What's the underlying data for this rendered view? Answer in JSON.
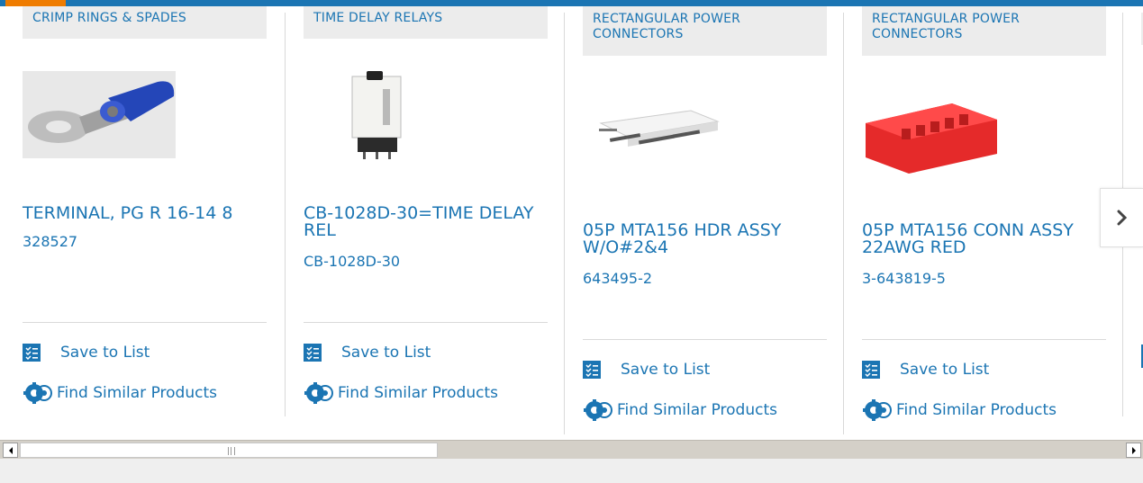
{
  "cards": [
    {
      "category": "CRIMP RINGS & SPADES",
      "title": "TERMINAL, PG R 16-14 8",
      "part_number": "328527",
      "save_label": "Save to List",
      "similar_label": "Find Similar Products"
    },
    {
      "category": "TIME DELAY RELAYS",
      "title": "CB-1028D-30=TIME DELAY REL",
      "part_number": "CB-1028D-30",
      "save_label": "Save to List",
      "similar_label": "Find Similar Products"
    },
    {
      "category": "RECTANGULAR POWER CONNECTORS",
      "title": "05P MTA156 HDR ASSY W/O#2&4",
      "part_number": "643495-2",
      "save_label": "Save to List",
      "similar_label": "Find Similar Products"
    },
    {
      "category": "RECTANGULAR POWER CONNECTORS",
      "title": "05P MTA156 CONN ASSY 22AWG RED",
      "part_number": "3-643819-5",
      "save_label": "Save to List",
      "similar_label": "Find Similar Products"
    }
  ],
  "colors": {
    "accent_blue": "#1b75b3",
    "accent_orange": "#ef7c00"
  },
  "icons": {
    "next": "chevron-right-icon",
    "save": "checklist-icon",
    "similar": "gears-icon"
  }
}
